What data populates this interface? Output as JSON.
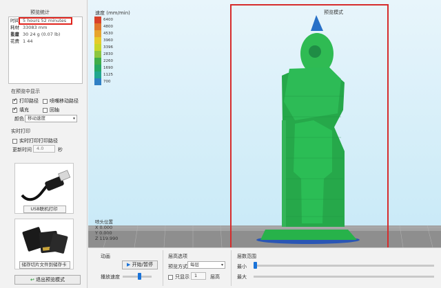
{
  "left": {
    "preview_group_title": "预览统计",
    "stats": [
      {
        "key": "时间",
        "value": "5 hours 52 minutes"
      },
      {
        "key": "耗材长度",
        "value": "33083 mm"
      },
      {
        "key": "重量",
        "value": "30 24 g (0.07 lb)"
      },
      {
        "key": "花费",
        "value": "1 44"
      }
    ],
    "display_group_title": "在预览中显示",
    "options": [
      {
        "label": "打印路径",
        "checked": true
      },
      {
        "label": "喷嘴移动路径",
        "checked": false
      },
      {
        "label": "填充",
        "checked": true
      },
      {
        "label": "回抽",
        "checked": false
      }
    ],
    "color_label": "颜色",
    "color_select": "移动速度",
    "realtime_group_title": "实时打印",
    "realtime_option": {
      "label": "实时打印打印路径",
      "checked": false
    },
    "update_time_label": "更新时间",
    "update_time_value": "4.0",
    "update_time_unit": "秒",
    "usb_card_caption": "USB联机打印",
    "sd_card_caption": "储存切片文件到储存卡",
    "exit_button": "退出预览模式"
  },
  "viewport": {
    "legend_title": "速度 (mm/min)",
    "legend": [
      {
        "value": "6400",
        "color": "#d9412a"
      },
      {
        "value": "4800",
        "color": "#e0782d"
      },
      {
        "value": "4530",
        "color": "#e7a52c"
      },
      {
        "value": "3960",
        "color": "#e6cb2a"
      },
      {
        "value": "3396",
        "color": "#c8d62a"
      },
      {
        "value": "2830",
        "color": "#8cc63f"
      },
      {
        "value": "2260",
        "color": "#3fae49"
      },
      {
        "value": "1690",
        "color": "#25a863"
      },
      {
        "value": "1125",
        "color": "#21a78f"
      },
      {
        "value": "700",
        "color": "#2f7fc4"
      }
    ],
    "mode_title": "预览模式",
    "coord_title": "喷头位置",
    "coords": [
      {
        "axis": "X",
        "value": "0.000"
      },
      {
        "axis": "Y",
        "value": "0.000"
      },
      {
        "axis": "Z",
        "value": "119.990"
      }
    ]
  },
  "bottom": {
    "animation_title": "动画",
    "play_button": "开始/暂停",
    "play_speed_label": "播放速度",
    "layer_title": "层高选项",
    "preview_mode_label": "预览方式",
    "preview_mode_value": "每层",
    "only_show_label": "只显示",
    "only_show_value": "1",
    "layer_unit": "层高",
    "range_title": "层数范围",
    "min_label": "最小",
    "max_label": "最大"
  }
}
